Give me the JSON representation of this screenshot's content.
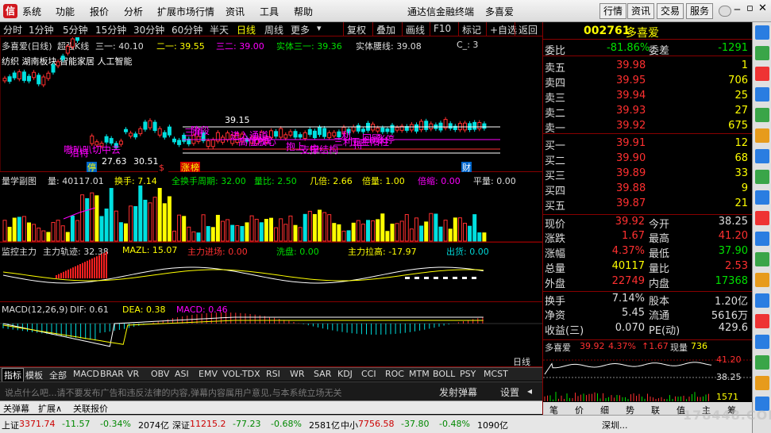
{
  "menu": {
    "logo": "信",
    "items": [
      "系统",
      "功能",
      "报价",
      "分析",
      "扩展市场行情",
      "资讯",
      "工具",
      "帮助"
    ],
    "app_title": "通达信金融终端",
    "stock_name_title": "多喜爱",
    "right_buttons": [
      "行情",
      "资讯",
      "交易",
      "服务"
    ]
  },
  "tabbar": {
    "periods": [
      "分时",
      "1分钟",
      "5分钟",
      "15分钟",
      "30分钟",
      "60分钟",
      "半天",
      "日线",
      "周线"
    ],
    "more": "更多",
    "buttons": [
      "复权",
      "叠加",
      "画线",
      "F10",
      "标记",
      "+自选",
      "返回"
    ]
  },
  "kline": {
    "title": "多喜爱(日线)",
    "indicator": "超强K线",
    "labels": [
      {
        "k": "三一",
        "v": "40.10"
      },
      {
        "k": "二一",
        "v": "39.55"
      },
      {
        "k": "三二",
        "v": "39.00"
      },
      {
        "k": "实体三一",
        "v": "39.36"
      },
      {
        "k": "实体腰线",
        "v": "39.08"
      },
      {
        "k": "C_",
        "v": "3"
      }
    ],
    "concepts": "纺织  湖南板块  智能家居  人工智能",
    "price_high": "39.15",
    "price_low1": "27.63",
    "price_low2": "30.51",
    "signals": [
      "嗷叭叭切中去",
      "沿特",
      "三角",
      "阶段",
      "进入通道",
      "高位放心",
      "抄底",
      "抱上",
      "支撑结构",
      "三利",
      "五金阳柱",
      "回顾",
      "涨停",
      "中",
      "利",
      "持"
    ],
    "tags": [
      "停",
      "$",
      "涨",
      "榜",
      "财"
    ]
  },
  "volume": {
    "title": "量学副图",
    "items": [
      {
        "k": "量",
        "v": "40117.01",
        "c": "w"
      },
      {
        "k": "换手",
        "v": "7.14",
        "c": "y"
      },
      {
        "k": "全换手周期",
        "v": "32.00",
        "c": "g"
      },
      {
        "k": "量比",
        "v": "2.50",
        "c": "g"
      },
      {
        "k": "几倍",
        "v": "2.66",
        "c": "y"
      },
      {
        "k": "倍量",
        "v": "1.00",
        "c": "y"
      },
      {
        "k": "倍缩",
        "v": "0.00",
        "c": "m"
      },
      {
        "k": "平量",
        "v": "0.00",
        "c": "w"
      }
    ]
  },
  "main_force": {
    "title": "监控主力",
    "items": [
      {
        "k": "主力轨迹",
        "v": "32.38",
        "c": "w"
      },
      {
        "k": "MAZL",
        "v": "15.07",
        "c": "y"
      },
      {
        "k": "主力进场",
        "v": "0.00",
        "c": "r"
      },
      {
        "k": "洗盘",
        "v": "0.00",
        "c": "g"
      },
      {
        "k": "主力拉高",
        "v": "-17.97",
        "c": "y"
      },
      {
        "k": "出货",
        "v": "0.00",
        "c": "c"
      }
    ]
  },
  "macd": {
    "title": "MACD(12,26,9)",
    "items": [
      {
        "k": "DIF",
        "v": "0.61",
        "c": "w"
      },
      {
        "k": "DEA",
        "v": "0.38",
        "c": "y"
      },
      {
        "k": "MACD",
        "v": "0.46",
        "c": "m"
      }
    ]
  },
  "indicators": {
    "tabs": [
      "指标",
      "模板",
      "全部",
      "MACD",
      "BRAR",
      "VR",
      "OBV",
      "ASI",
      "EMV",
      "VOL-TDX",
      "RSI",
      "WR",
      "SAR",
      "KDJ",
      "CCI",
      "ROC",
      "MTM",
      "BOLL",
      "PSY",
      "MCST"
    ]
  },
  "danmu": {
    "placeholder": "说点什么吧...请不要发布广告和违反法律的内容,弹幕内容属用户意见,与本系统立场无关",
    "send": "发射弹幕",
    "settings": "设置"
  },
  "bottom_tabs": [
    "关弹幕",
    "扩展∧",
    "关联报价"
  ],
  "quote": {
    "code": "002761",
    "name": "多喜爱",
    "weibi_label": "委比",
    "weibi": "-81.86%",
    "weicha_label": "委差",
    "weicha": "-1291",
    "asks": [
      {
        "label": "卖五",
        "price": "39.98",
        "vol": "1"
      },
      {
        "label": "卖四",
        "price": "39.95",
        "vol": "706"
      },
      {
        "label": "卖三",
        "price": "39.94",
        "vol": "25"
      },
      {
        "label": "卖二",
        "price": "39.93",
        "vol": "27"
      },
      {
        "label": "卖一",
        "price": "39.92",
        "vol": "675"
      }
    ],
    "bids": [
      {
        "label": "买一",
        "price": "39.91",
        "vol": "12"
      },
      {
        "label": "买二",
        "price": "39.90",
        "vol": "68"
      },
      {
        "label": "买三",
        "price": "39.89",
        "vol": "33"
      },
      {
        "label": "买四",
        "price": "39.88",
        "vol": "9"
      },
      {
        "label": "买五",
        "price": "39.87",
        "vol": "21"
      }
    ],
    "stats": [
      {
        "l1": "现价",
        "v1": "39.92",
        "c1": "r",
        "l2": "今开",
        "v2": "38.25",
        "c2": "w"
      },
      {
        "l1": "涨跌",
        "v1": "1.67",
        "c1": "r",
        "l2": "最高",
        "v2": "41.20",
        "c2": "r"
      },
      {
        "l1": "涨幅",
        "v1": "4.37%",
        "c1": "r",
        "l2": "最低",
        "v2": "37.90",
        "c2": "g"
      },
      {
        "l1": "总量",
        "v1": "40117",
        "c1": "y",
        "l2": "量比",
        "v2": "2.53",
        "c2": "r"
      },
      {
        "l1": "外盘",
        "v1": "22749",
        "c1": "r",
        "l2": "内盘",
        "v2": "17368",
        "c2": "g"
      }
    ],
    "stats2": [
      {
        "l1": "换手",
        "v1": "7.14%",
        "l2": "股本",
        "v2": "1.20亿"
      },
      {
        "l1": "净资",
        "v1": "5.45",
        "l2": "流通",
        "v2": "5616万"
      },
      {
        "l1": "收益(三)",
        "v1": "0.070",
        "l2": "PE(动)",
        "v2": "429.6"
      }
    ],
    "mini": {
      "name": "多喜爱",
      "price": "39.92",
      "pct": "4.37%",
      "chg": "1.67",
      "vol_label": "现量",
      "vol": "736",
      "high": "41.20",
      "mid": "38.25",
      "bottom": "1571",
      "day_label": "日线"
    },
    "mini_tabs": [
      "笔",
      "价",
      "细",
      "势",
      "联",
      "值",
      "主",
      "筹"
    ]
  },
  "statusbar": [
    {
      "k": "上证",
      "v": "3371.74",
      "v2": "-11.57",
      "v3": "-0.34%",
      "v4": "2074亿"
    },
    {
      "k": "深证",
      "v": "11215.2",
      "v2": "-77.23",
      "v3": "-0.68%",
      "v4": "2581亿"
    },
    {
      "k": "中小",
      "v": "7756.58",
      "v2": "-37.80",
      "v3": "-0.48%",
      "v4": "1090亿"
    }
  ],
  "status_extra": "深圳...",
  "watermark": "178448.COM",
  "colors": {
    "up": "#ff3030",
    "down": "#00e0e0",
    "border": "#800000",
    "yellow": "#ffff00",
    "magenta": "#ff00ff"
  }
}
